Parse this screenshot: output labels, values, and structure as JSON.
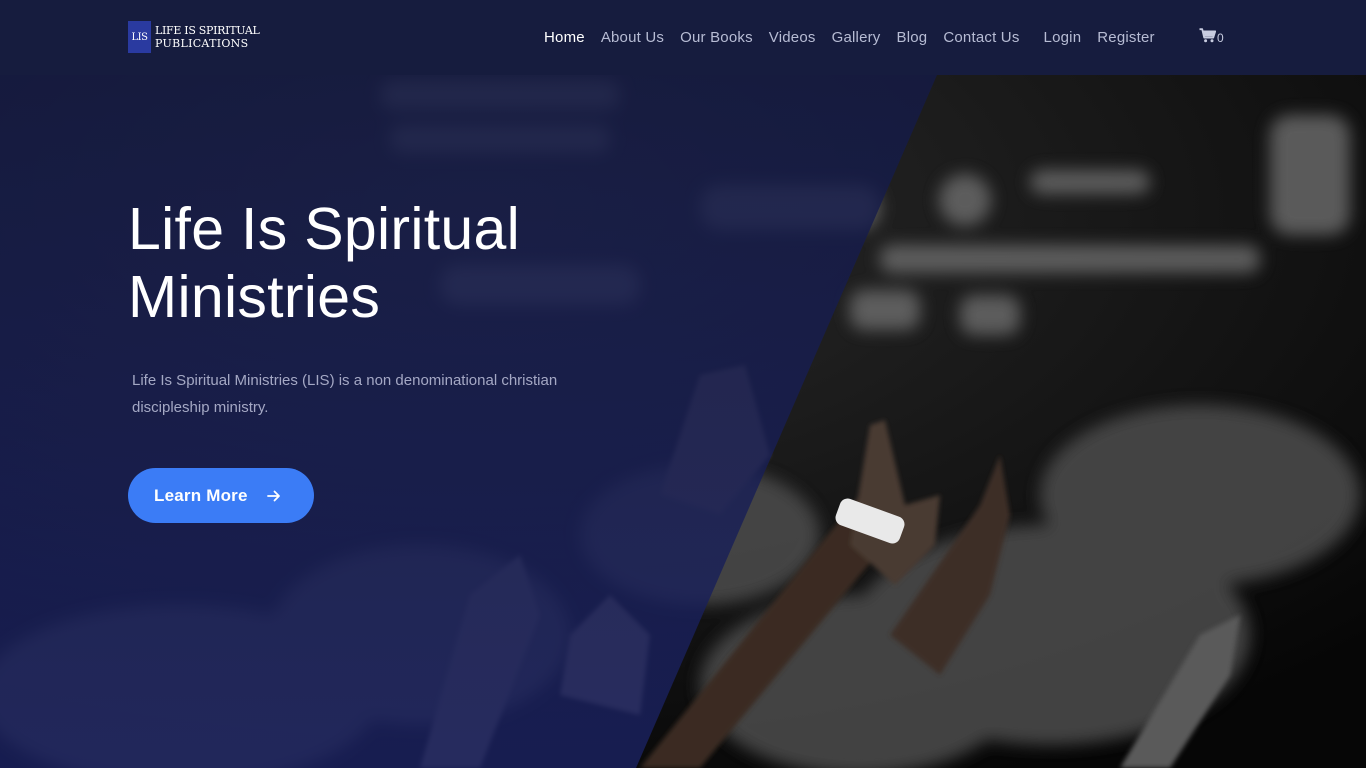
{
  "logo": {
    "mark_text": "LIS",
    "line1": "LIFE IS SPIRITUAL",
    "line2": "PUBLICATIONS",
    "mark_color": "#2a3aa0"
  },
  "nav": {
    "items": [
      {
        "label": "Home",
        "active": true
      },
      {
        "label": "About Us",
        "active": false
      },
      {
        "label": "Our Books",
        "active": false
      },
      {
        "label": "Videos",
        "active": false
      },
      {
        "label": "Gallery",
        "active": false
      },
      {
        "label": "Blog",
        "active": false
      },
      {
        "label": "Contact Us",
        "active": false
      }
    ],
    "account": [
      {
        "label": "Login"
      },
      {
        "label": "Register"
      }
    ],
    "cart": {
      "icon": "cart-icon",
      "count": "0"
    }
  },
  "hero": {
    "title_line1": "Life Is Spiritual",
    "title_line2": "Ministries",
    "description": "Life Is Spiritual Ministries (LIS) is a non denominational christian discipleship ministry.",
    "cta_label": "Learn More",
    "cta_icon": "arrow-right-icon",
    "background_image": "raised-hands-photo",
    "overlay_color": "#161c4a",
    "accent": "#3b7cf6"
  }
}
